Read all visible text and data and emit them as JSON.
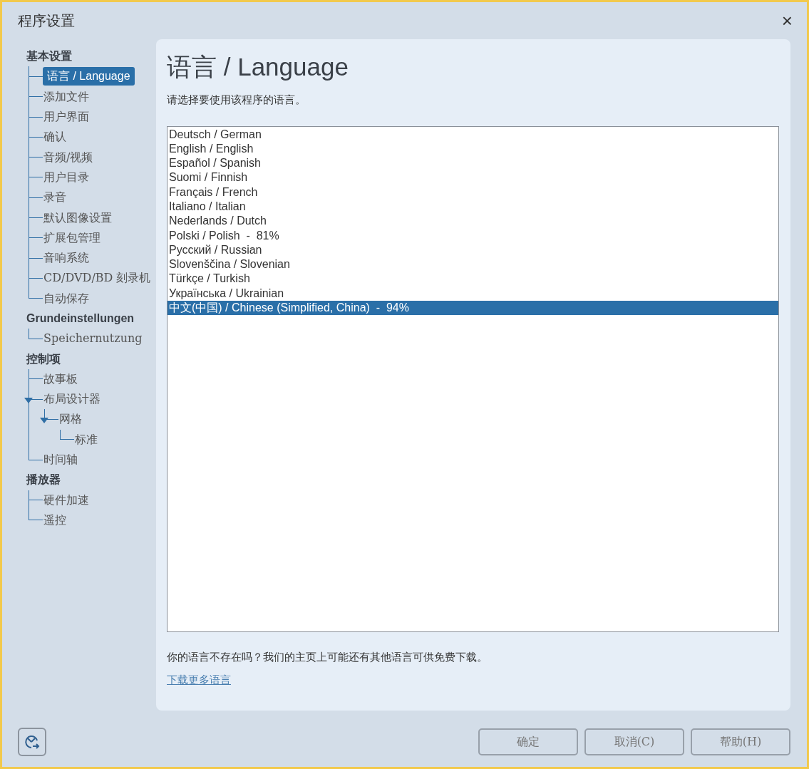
{
  "window": {
    "title": "程序设置",
    "close": "×"
  },
  "sidebar": [
    {
      "label": "基本设置",
      "children": [
        {
          "label": "语言 / Language",
          "selected": true
        },
        {
          "label": "添加文件",
          "selected": false
        },
        {
          "label": "用户界面",
          "selected": false
        },
        {
          "label": "确认",
          "selected": false
        },
        {
          "label": "音频/视频",
          "selected": false
        },
        {
          "label": "用户目录",
          "selected": false
        },
        {
          "label": "录音",
          "selected": false
        },
        {
          "label": "默认图像设置",
          "selected": false
        },
        {
          "label": "扩展包管理",
          "selected": false
        },
        {
          "label": "音响系统",
          "selected": false
        },
        {
          "label": "CD/DVD/BD 刻录机",
          "selected": false
        },
        {
          "label": "自动保存",
          "selected": false
        }
      ]
    },
    {
      "label": "Grundeinstellungen",
      "children": [
        {
          "label": "Speichernutzung",
          "selected": false
        }
      ]
    },
    {
      "label": "控制项",
      "children": [
        {
          "label": "故事板",
          "selected": false
        },
        {
          "label": "布局设计器",
          "selected": false,
          "expanded": true,
          "children": [
            {
              "label": "网格",
              "selected": false,
              "expanded": true,
              "children": [
                {
                  "label": "标准",
                  "selected": false
                }
              ]
            }
          ]
        },
        {
          "label": "时间轴",
          "selected": false
        }
      ]
    },
    {
      "label": "播放器",
      "children": [
        {
          "label": "硬件加速",
          "selected": false
        },
        {
          "label": "遥控",
          "selected": false
        }
      ]
    }
  ],
  "panel": {
    "heading": "语言 / Language",
    "description": "请选择要使用该程序的语言。",
    "languages": [
      {
        "label": "Deutsch / German",
        "selected": false
      },
      {
        "label": "English / English",
        "selected": false
      },
      {
        "label": "Español / Spanish",
        "selected": false
      },
      {
        "label": "Suomi / Finnish",
        "selected": false
      },
      {
        "label": "Français / French",
        "selected": false
      },
      {
        "label": "Italiano / Italian",
        "selected": false
      },
      {
        "label": "Nederlands / Dutch",
        "selected": false
      },
      {
        "label": "Polski / Polish  -  81%",
        "selected": false
      },
      {
        "label": "Русский / Russian",
        "selected": false
      },
      {
        "label": "Slovenščina / Slovenian",
        "selected": false
      },
      {
        "label": "Türkçe / Turkish",
        "selected": false
      },
      {
        "label": "Українська / Ukrainian",
        "selected": false
      },
      {
        "label": "中文(中国) / Chinese (Simplified, China)  -  94%",
        "selected": true
      }
    ],
    "note": "你的语言不存在吗？我们的主页上可能还有其他语言可供免费下载。",
    "link": "下载更多语言"
  },
  "buttons": [
    {
      "label": "确定"
    },
    {
      "label": "取消(C)"
    },
    {
      "label": "帮助(H)"
    }
  ]
}
